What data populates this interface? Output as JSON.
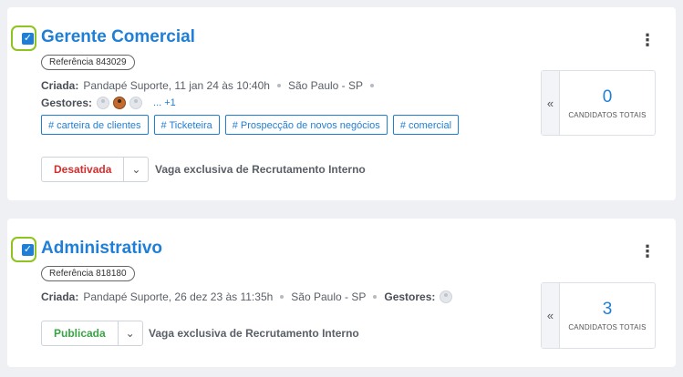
{
  "jobs": [
    {
      "title": "Gerente Comercial",
      "reference": "Referência 843029",
      "created_label": "Criada:",
      "created_by": "Pandapé Suporte, 11 jan 24 às 10:40h",
      "location": "São Paulo - SP",
      "managers_label": "Gestores:",
      "managers_more": "... +1",
      "tags": [
        "# carteira de clientes",
        "# Ticketeira",
        "# Prospecção de novos negócios",
        "# comercial"
      ],
      "status": "Desativada",
      "status_color": "#d32f2f",
      "exclusive_note": "Vaga exclusiva de Recrutamento Interno",
      "candidates_count": "0",
      "candidates_label": "CANDIDATOS TOTAIS",
      "checked": true
    },
    {
      "title": "Administrativo",
      "reference": "Referência 818180",
      "created_label": "Criada:",
      "created_by": "Pandapé Suporte, 26 dez 23 às 11:35h",
      "location": "São Paulo - SP",
      "managers_label": "Gestores:",
      "status": "Publicada",
      "status_color": "#3aa346",
      "exclusive_note": "Vaga exclusiva de Recrutamento Interno",
      "candidates_count": "3",
      "candidates_label": "CANDIDATOS TOTAIS",
      "checked": true
    }
  ],
  "icons": {
    "checkbox": "check-icon",
    "kebab": "more-vertical-icon",
    "caret": "chevron-down-icon",
    "collapse": "double-chevron-left-icon",
    "avatar": "user-avatar-icon"
  },
  "colors": {
    "accent": "#1f7fd6",
    "selection_ring": "#8fc31f",
    "background": "#eef0f4"
  }
}
